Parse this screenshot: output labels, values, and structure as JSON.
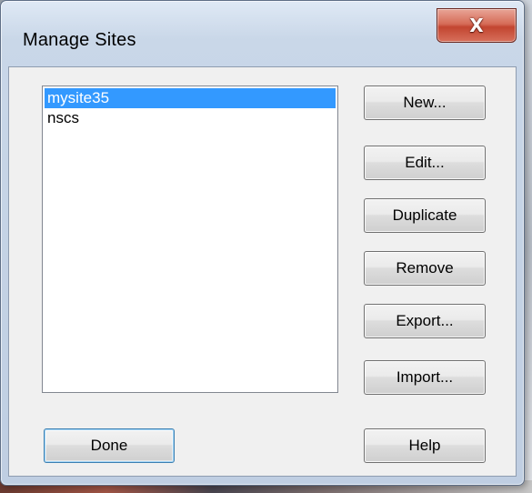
{
  "window": {
    "title": "Manage Sites",
    "close_symbol": "X"
  },
  "sites": [
    {
      "name": "mysite35",
      "selected": true
    },
    {
      "name": "nscs",
      "selected": false
    }
  ],
  "buttons": {
    "new": "New...",
    "edit": "Edit...",
    "duplicate": "Duplicate",
    "remove": "Remove",
    "export": "Export...",
    "import": "Import...",
    "done": "Done",
    "help": "Help"
  },
  "colors": {
    "selection_bg": "#3399ff",
    "selection_text": "#ffffff",
    "close_button": "#c24530"
  },
  "icons": {
    "close": "close-icon"
  }
}
